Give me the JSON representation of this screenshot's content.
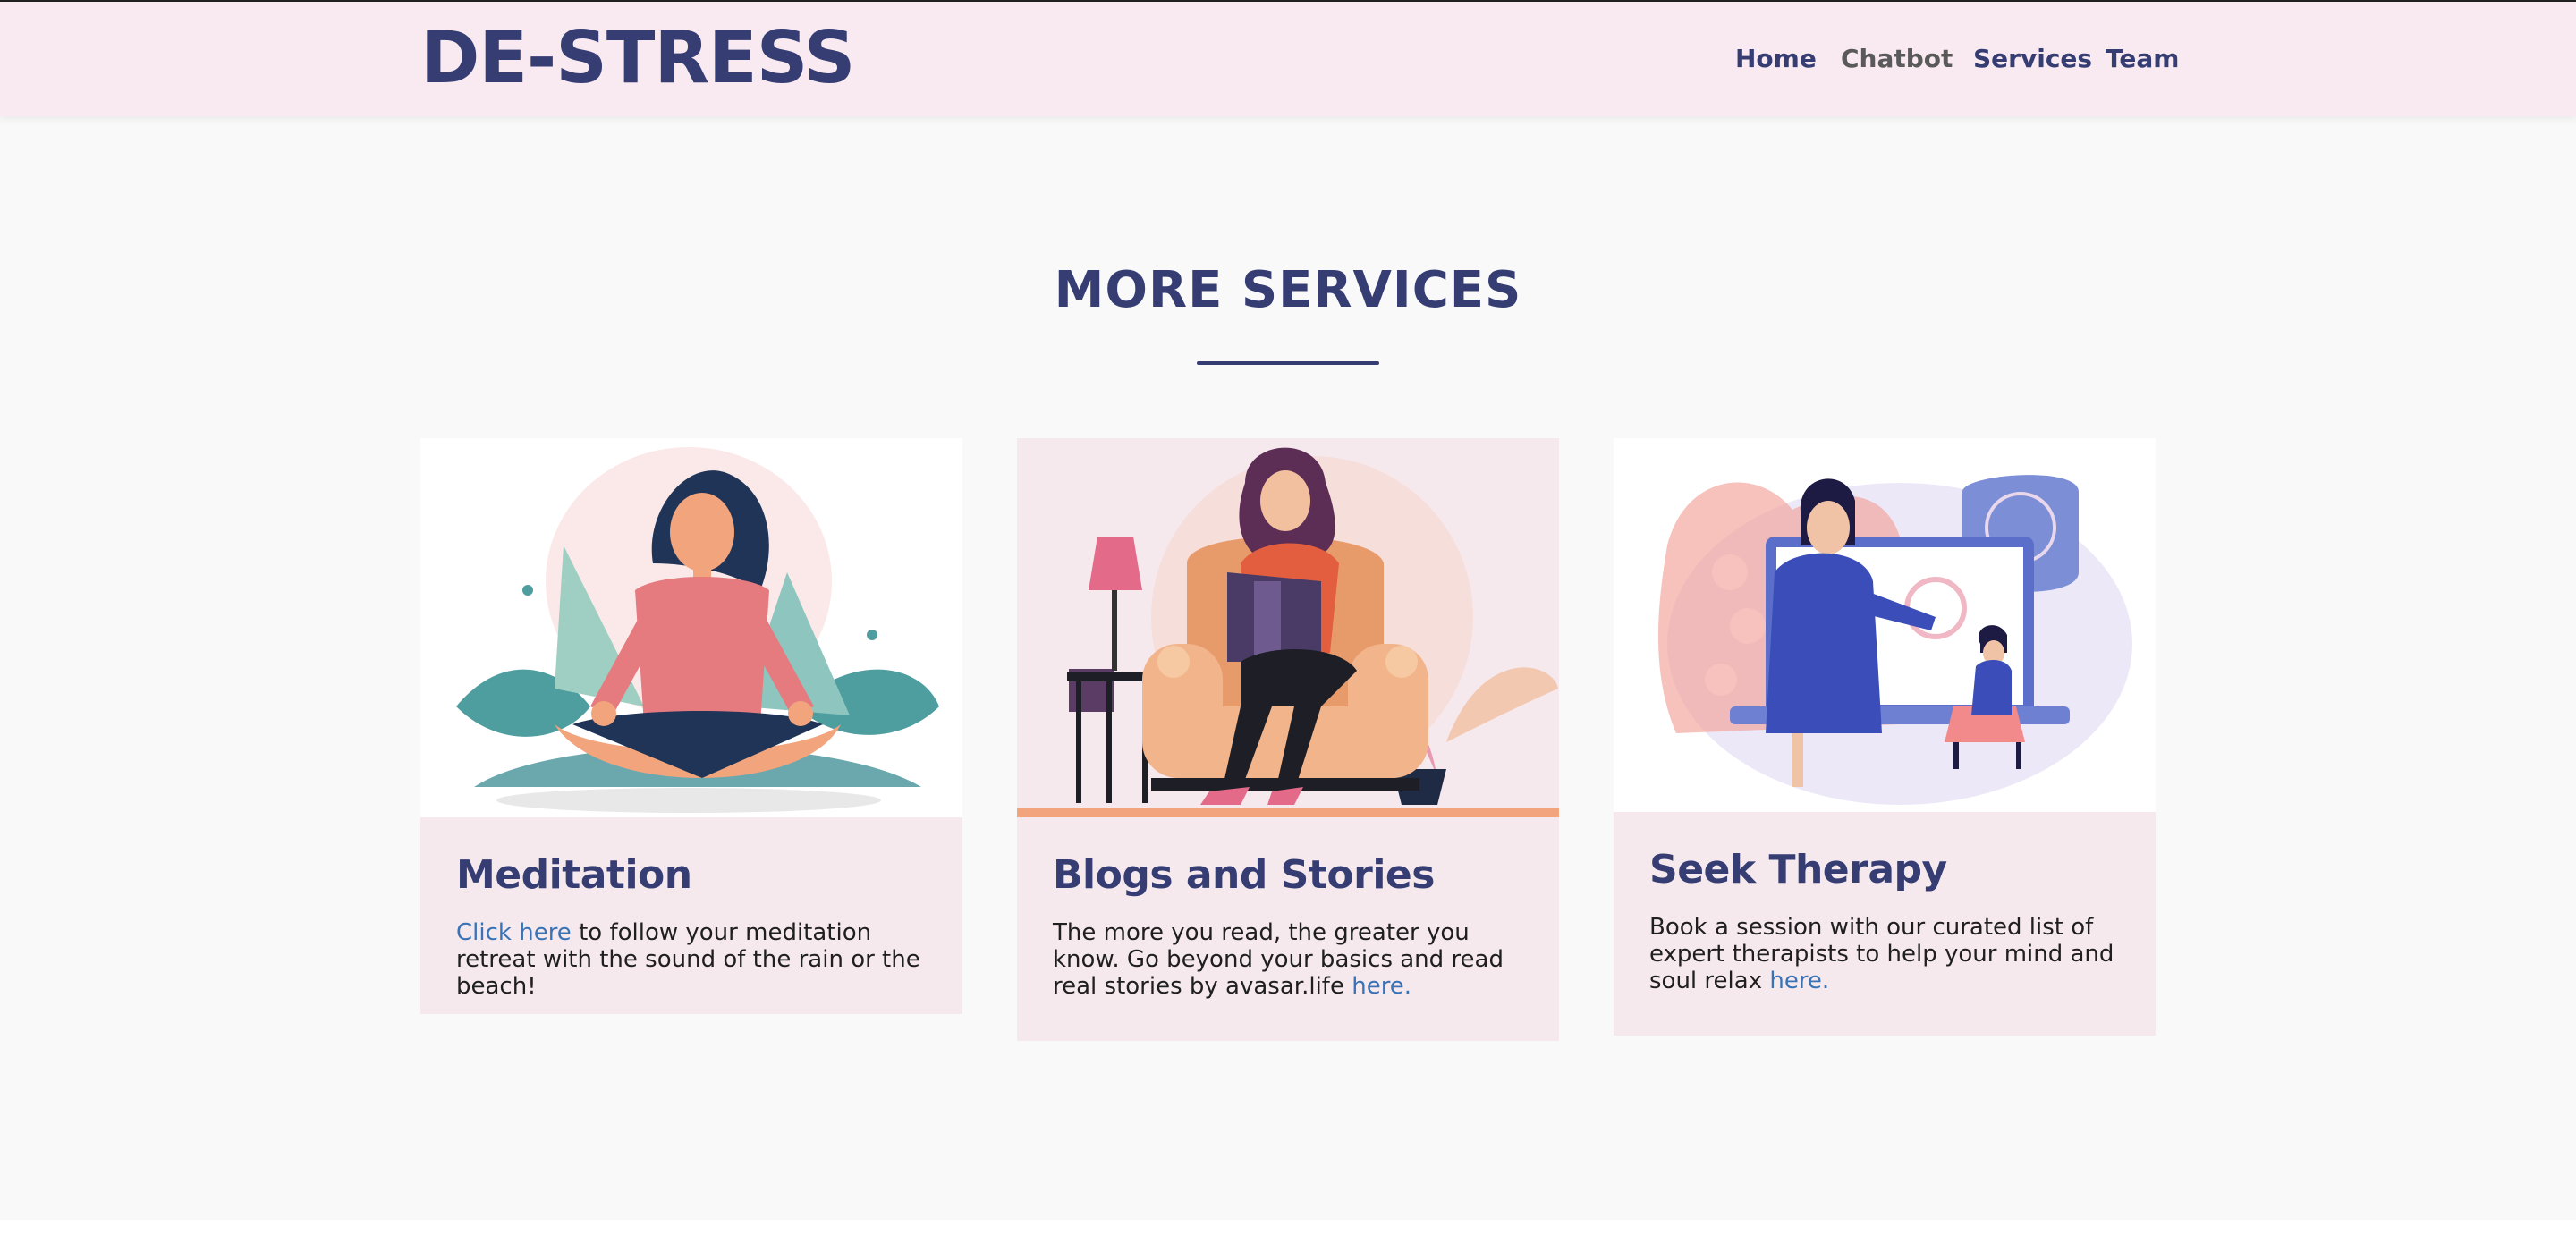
{
  "brand": {
    "title": "DE-STRESS"
  },
  "nav": {
    "items": [
      {
        "label": "Home"
      },
      {
        "label": "Chatbot"
      },
      {
        "label": "Services"
      },
      {
        "label": "Team"
      }
    ]
  },
  "section": {
    "title": "MORE SERVICES"
  },
  "cards": [
    {
      "title": "Meditation",
      "link_text": "Click here",
      "text_after": " to follow your meditation retreat with the sound of the rain or the beach!"
    },
    {
      "title": "Blogs and Stories",
      "text_before": "The more you read, the greater you know. Go beyond your basics and read real stories by avasar.life ",
      "link_text": "here."
    },
    {
      "title": "Seek Therapy",
      "text_before": "Book a session with our curated list of expert therapists to help your mind and soul relax ",
      "link_text": "here."
    }
  ],
  "colors": {
    "primary": "#353d73",
    "nav_bg": "#f8eaf0",
    "card_bg": "#f6e9ee",
    "link": "#3a73b5",
    "page_bg": "#f9f9f9"
  },
  "icons": {
    "card_1": "meditation-illustration",
    "card_2": "reading-illustration",
    "card_3": "therapy-illustration"
  }
}
